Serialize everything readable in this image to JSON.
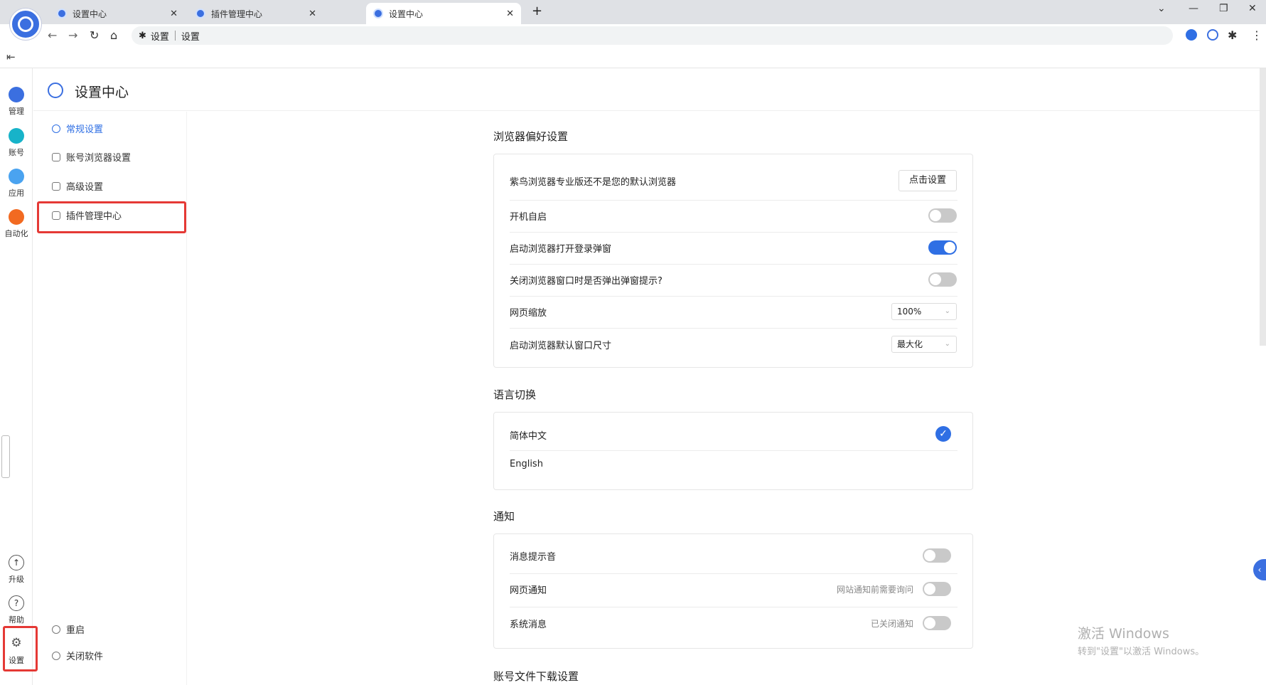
{
  "browser": {
    "tabs": [
      {
        "label": "设置中心",
        "active": false
      },
      {
        "label": "插件管理中心",
        "active": false
      },
      {
        "label": "设置中心",
        "active": true
      }
    ],
    "new_tab": "+",
    "omnibox": {
      "site": "设置",
      "path": "设置"
    }
  },
  "rail": {
    "items": [
      {
        "label": "管理",
        "icon": "grid-icon",
        "color": "#3b6fe0"
      },
      {
        "label": "账号",
        "icon": "store-icon",
        "color": "#17b3c9"
      },
      {
        "label": "应用",
        "icon": "apps-icon",
        "color": "#4aa3f0"
      },
      {
        "label": "自动化",
        "icon": "robot-icon",
        "color": "#f26a21"
      }
    ],
    "bottom": [
      {
        "label": "升级",
        "icon": "upgrade-icon"
      },
      {
        "label": "帮助",
        "icon": "help-icon"
      },
      {
        "label": "设置",
        "icon": "gear-icon"
      }
    ]
  },
  "header": {
    "title": "设置中心"
  },
  "sidebar": {
    "items": [
      {
        "label": "常规设置",
        "active": true
      },
      {
        "label": "账号浏览器设置",
        "active": false
      },
      {
        "label": "高级设置",
        "active": false
      },
      {
        "label": "插件管理中心",
        "active": false
      }
    ],
    "bottom": [
      {
        "label": "重启"
      },
      {
        "label": "关闭软件"
      }
    ]
  },
  "sections": {
    "browser_prefs": {
      "title": "浏览器偏好设置",
      "rows": {
        "default_browser": {
          "label": "紫鸟浏览器专业版还不是您的默认浏览器",
          "button": "点击设置"
        },
        "autostart": {
          "label": "开机自启",
          "on": false
        },
        "login_popup": {
          "label": "启动浏览器打开登录弹窗",
          "on": true
        },
        "close_prompt": {
          "label": "关闭浏览器窗口时是否弹出弹窗提示?",
          "on": false
        },
        "zoom": {
          "label": "网页缩放",
          "value": "100%"
        },
        "window_size": {
          "label": "启动浏览器默认窗口尺寸",
          "value": "最大化"
        }
      }
    },
    "language": {
      "title": "语言切换",
      "options": [
        {
          "label": "简体中文",
          "selected": true
        },
        {
          "label": "English",
          "selected": false
        }
      ]
    },
    "notify": {
      "title": "通知",
      "rows": {
        "sound": {
          "label": "消息提示音",
          "on": false
        },
        "web": {
          "label": "网页通知",
          "hint": "网站通知前需要询问",
          "on": false
        },
        "system": {
          "label": "系统消息",
          "hint": "已关闭通知",
          "on": false
        }
      }
    },
    "download": {
      "title": "账号文件下载设置"
    }
  },
  "watermark": {
    "line1": "激活 Windows",
    "line2": "转到\"设置\"以激活 Windows。"
  },
  "colors": {
    "accent": "#2f6fe4",
    "highlight": "#e53935"
  }
}
